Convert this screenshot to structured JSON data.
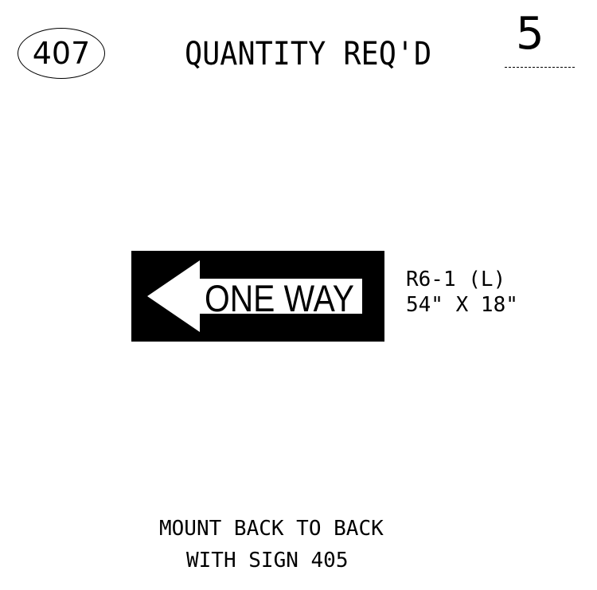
{
  "header": {
    "sheet_number": "407",
    "quantity_label": "QUANTITY REQ'D",
    "quantity_value": "5"
  },
  "sign": {
    "legend": "ONE WAY",
    "arrow_direction": "left",
    "code": "R6-1 (L)",
    "size": "54\" X 18\"",
    "background_color": "#000000",
    "legend_color": "#000000",
    "panel_color": "#ffffff",
    "arrow_icon": "left-arrow-icon"
  },
  "note": {
    "line1": "MOUNT BACK TO BACK",
    "line2": "WITH SIGN 405"
  }
}
